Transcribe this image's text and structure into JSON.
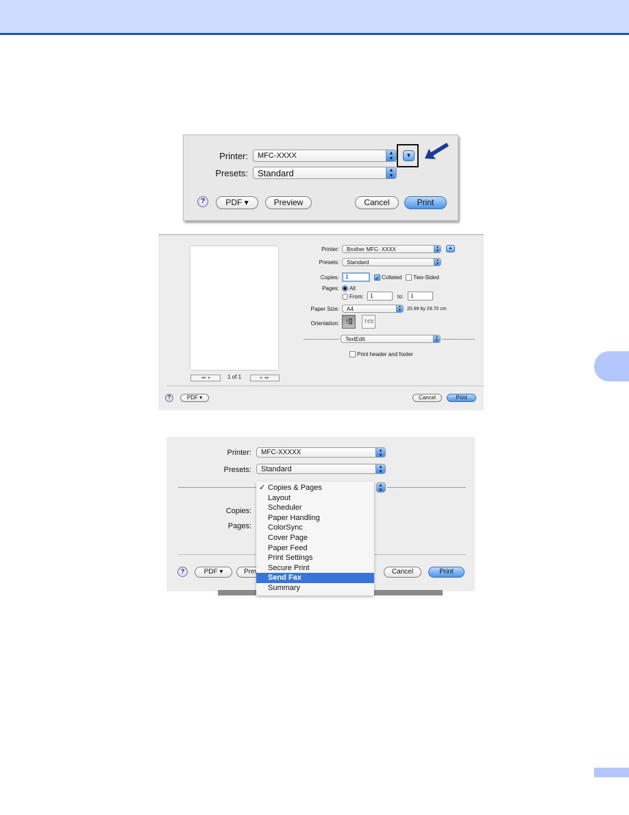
{
  "header": {
    "band_color": "#ccdcfd",
    "rule_color": "#1a55b5"
  },
  "dialog1": {
    "printer_label": "Printer:",
    "printer_value": "MFC-XXXX",
    "presets_label": "Presets:",
    "presets_value": "Standard",
    "expand_icon": "disclosure-triangle-down",
    "help": "?",
    "pdf": "PDF ▾",
    "preview": "Preview",
    "cancel": "Cancel",
    "print": "Print",
    "callout": "arrow pointing to expand button"
  },
  "dialog2": {
    "printer_label": "Printer:",
    "printer_value": "Brother  MFC- XXXX",
    "presets_label": "Presets:",
    "presets_value": "Standard",
    "copies_label": "Copies:",
    "copies_value": "1",
    "collated_label": "Collated",
    "collated_checked": true,
    "two_sided_label": "Two-Sided",
    "two_sided_checked": false,
    "pages_label": "Pages:",
    "pages_all": "All",
    "pages_from": "From:",
    "from_value": "1",
    "to_label": "to:",
    "to_value": "1",
    "paper_size_label": "Paper Size:",
    "paper_size_value": "A4",
    "paper_dimensions": "20.99 by 29.70 cm",
    "orientation_label": "Orientation:",
    "section_value": "TextEdit",
    "header_footer_label": "Print header and footer",
    "header_footer_checked": false,
    "page_counter": "1 of 1",
    "nav_first": "◂◂",
    "nav_prev": "◂",
    "nav_next": "▸",
    "nav_last": "▸▸",
    "help": "?",
    "pdf": "PDF ▾",
    "cancel": "Cancel",
    "print": "Print"
  },
  "dialog3": {
    "printer_label": "Printer:",
    "printer_value": "MFC-XXXXX",
    "presets_label": "Presets:",
    "presets_value": "Standard",
    "copies_label": "Copies:",
    "pages_label": "Pages:",
    "help": "?",
    "pdf": "PDF ▾",
    "preview_partial": "Prev",
    "cancel": "Cancel",
    "print": "Print",
    "menu": {
      "checked_index": 0,
      "highlighted_index": 9,
      "highlight_color": "#3875d7",
      "items": [
        "Copies & Pages",
        "Layout",
        "Scheduler",
        "Paper Handling",
        "ColorSync",
        "Cover Page",
        "Paper Feed",
        "Print Settings",
        "Secure Print",
        "Send Fax",
        "Summary"
      ]
    }
  }
}
